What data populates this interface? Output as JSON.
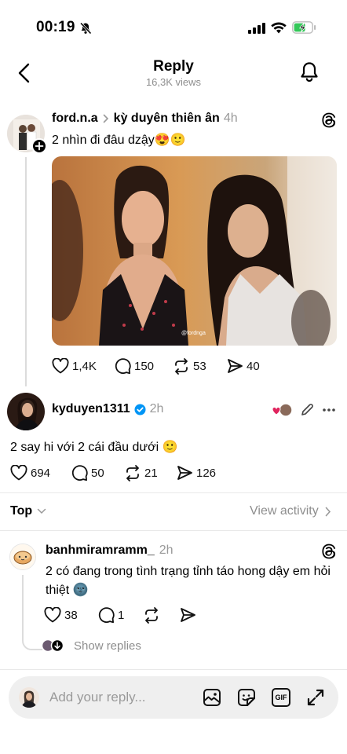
{
  "status_bar": {
    "time": "00:19",
    "silent_icon": "bell-slash-icon",
    "signal_icon": "signal-icon",
    "wifi_icon": "wifi-icon",
    "battery_icon": "battery-charging-icon",
    "battery_color": "#34c759"
  },
  "header": {
    "title": "Reply",
    "subtitle": "16,3K views",
    "back_icon": "chevron-left-icon",
    "bell_icon": "bell-icon"
  },
  "original_post": {
    "author": "ford.n.a",
    "reply_to": "kỳ duyên thiên ân",
    "time": "4h",
    "text": "2 nhìn đi đâu dzậy😍🙂",
    "image_alt": "photo of two women",
    "image_watermark": "@fordnga",
    "likes": "1,4K",
    "replies": "150",
    "reposts": "53",
    "shares": "40"
  },
  "main_reply": {
    "author": "kyduyen1311",
    "verified": true,
    "time": "2h",
    "text": "2 say hi với 2 cái đầu dưới 🙂",
    "likes": "694",
    "replies": "50",
    "reposts": "21",
    "shares": "126",
    "accent_color": "#e0245e",
    "verified_color": "#0095f6"
  },
  "sort_bar": {
    "label": "Top",
    "view_activity": "View activity"
  },
  "comment": {
    "author": "banhmiramramm_",
    "time": "2h",
    "text": "2 có đang trong tình trạng tỉnh táo hong dậy em hỏi thiệt 🌚",
    "likes": "38",
    "replies": "1",
    "show_replies": "Show replies"
  },
  "composer": {
    "placeholder": "Add your reply...",
    "gif_label": "GIF"
  }
}
